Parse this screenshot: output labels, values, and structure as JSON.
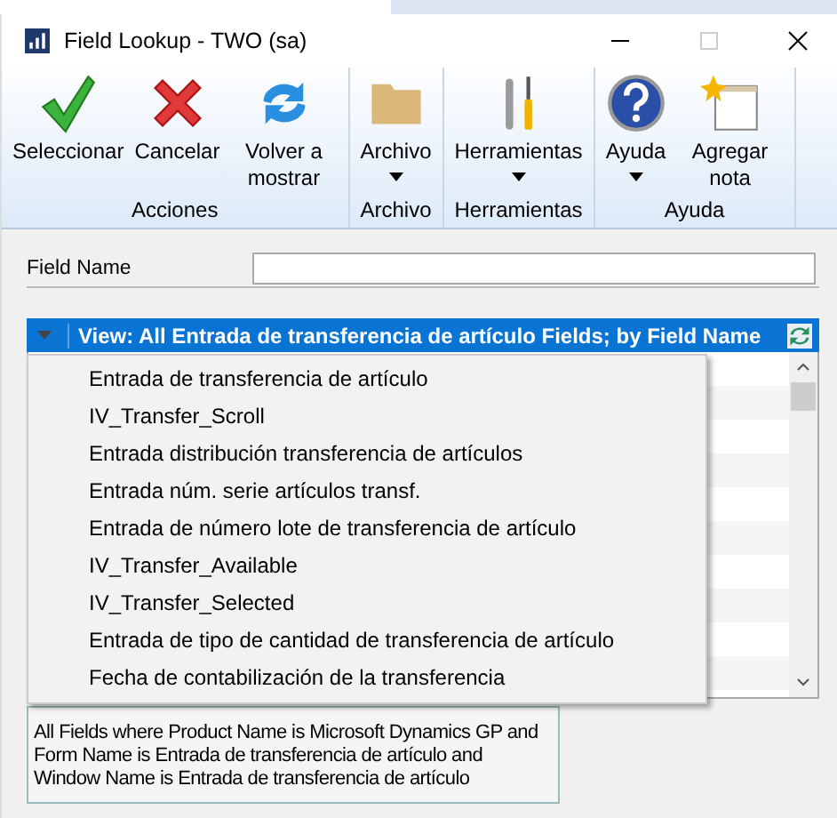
{
  "window": {
    "title": "Field Lookup  -  TWO (sa)"
  },
  "ribbon": [
    {
      "label": "Acciones",
      "buttons": [
        {
          "label": "Seleccionar",
          "kind": "check",
          "dropdown": false
        },
        {
          "label": "Cancelar",
          "kind": "cross",
          "dropdown": false
        },
        {
          "label": "Volver a mostrar",
          "kind": "refresh",
          "dropdown": false
        }
      ]
    },
    {
      "label": "Archivo",
      "buttons": [
        {
          "label": "Archivo",
          "kind": "folder",
          "dropdown": true
        }
      ]
    },
    {
      "label": "Herramientas",
      "buttons": [
        {
          "label": "Herramientas",
          "kind": "tools",
          "dropdown": true
        }
      ]
    },
    {
      "label": "Ayuda",
      "buttons": [
        {
          "label": "Ayuda",
          "kind": "help",
          "dropdown": true
        },
        {
          "label": "Agregar nota",
          "kind": "note",
          "dropdown": false
        }
      ]
    }
  ],
  "field_name": {
    "label": "Field Name"
  },
  "view_bar": {
    "title": "View: All Entrada de transferencia de artículo Fields; by Field Name"
  },
  "menu": {
    "items": [
      {
        "label": "Entrada de transferencia de artículo"
      },
      {
        "label": "IV_Transfer_Scroll"
      },
      {
        "label": "Entrada distribución transferencia de artículos"
      },
      {
        "label": "Entrada núm. serie artículos transf."
      },
      {
        "label": "Entrada de número lote de transferencia de artículo"
      },
      {
        "label": "IV_Transfer_Available"
      },
      {
        "label": "IV_Transfer_Selected"
      },
      {
        "label": "Entrada de tipo de cantidad de transferencia de artículo"
      },
      {
        "label": "Fecha de contabilización de la transferencia"
      }
    ]
  },
  "description": "All Fields where Product Name is Microsoft Dynamics GP and Form Name is Entrada de transferencia de artículo and Window Name is Entrada de transferencia de artículo"
}
